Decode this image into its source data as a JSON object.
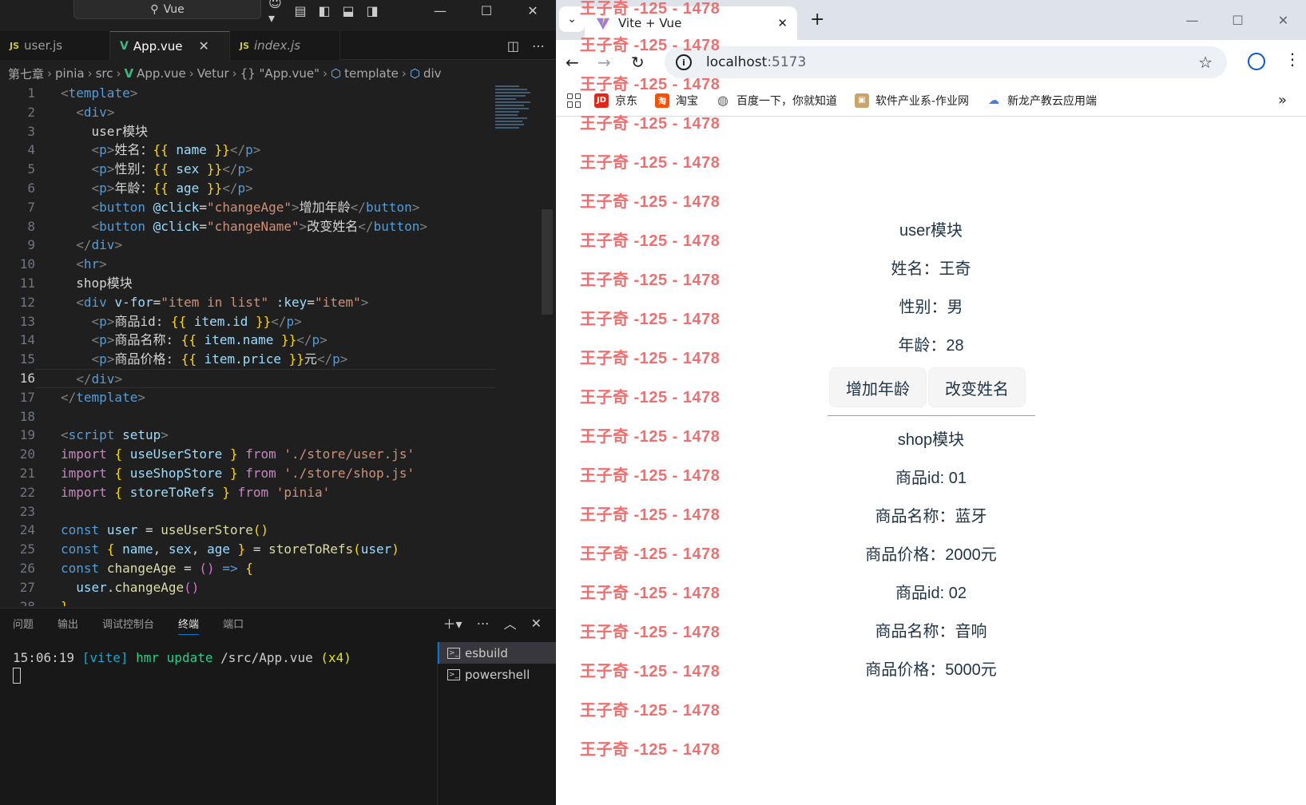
{
  "vscode": {
    "search_label": "Vue",
    "tabs": [
      {
        "icon": "JS",
        "label": "user.js"
      },
      {
        "icon": "V",
        "label": "App.vue"
      },
      {
        "icon": "JS",
        "label": "index.js"
      }
    ],
    "breadcrumb": [
      "第七章",
      "pinia",
      "src",
      "App.vue",
      "Vetur",
      "{} \"App.vue\"",
      "template",
      "div"
    ],
    "line_numbers": [
      "1",
      "2",
      "3",
      "4",
      "5",
      "6",
      "7",
      "8",
      "9",
      "10",
      "11",
      "12",
      "13",
      "14",
      "15",
      "16",
      "17",
      "18",
      "19",
      "20",
      "21",
      "22",
      "23",
      "24",
      "25",
      "26",
      "27",
      "28"
    ],
    "code": {
      "open_template": "template",
      "div": "div",
      "user_module": "user模块",
      "p": "p",
      "name_label": "姓名：",
      "sex_label": "性别：",
      "age_label": "年龄：",
      "var_name": "name",
      "var_sex": "sex",
      "var_age": "age",
      "button": "button",
      "click_attr": "@click",
      "change_age": "\"changeAge\"",
      "change_age_text": "增加年龄",
      "change_name": "\"changeName\"",
      "change_name_text": "改变姓名",
      "hr": "hr",
      "shop_module": "shop模块",
      "vfor_attr": "v-for",
      "vfor_val": "\"item in list\"",
      "key_attr": ":key",
      "key_val": "\"item\"",
      "item_id_label": "商品id: ",
      "item_name_label": "商品名称: ",
      "item_price_label": "商品价格: ",
      "item_id": "item.id",
      "item_name": "item.name",
      "item_price": "item.price",
      "yuan": "元",
      "script": "script",
      "setup": "setup",
      "import": "import",
      "from": "from",
      "useUserStore": "useUserStore",
      "useShopStore": "useShopStore",
      "storeToRefs": "storeToRefs",
      "path_user": "'./store/user.js'",
      "path_shop": "'./store/shop.js'",
      "path_pinia": "'pinia'",
      "const": "const",
      "user": "user",
      "changeAge": "changeAge",
      "call_change_age": "changeAge"
    },
    "panel_tabs": [
      "问题",
      "输出",
      "调试控制台",
      "终端",
      "端口"
    ],
    "terminal": {
      "time": "15:06:19",
      "tag": "[vite]",
      "hmr": "hmr update",
      "path": "/src/App.vue",
      "count": "(x4)"
    },
    "terminals": [
      "esbuild",
      "powershell"
    ]
  },
  "browser": {
    "tab_title": "Vite + Vue",
    "url_host": "localhost",
    "url_port": ":5173",
    "bookmarks": [
      {
        "label": "京东",
        "icon": "JD",
        "color": "#e1251b"
      },
      {
        "label": "淘宝",
        "icon": "淘",
        "color": "#ff5000"
      },
      {
        "label": "百度一下，你就知道",
        "icon": "globe",
        "color": "#5f6368"
      },
      {
        "label": "软件产业系-作业网",
        "icon": "img",
        "color": "#b08040"
      },
      {
        "label": "新龙产教云应用端",
        "icon": "cloud",
        "color": "#4a7fd8"
      }
    ],
    "page": {
      "user_title": "user模块",
      "name": "姓名：王奇",
      "sex": "性别：男",
      "age": "年龄：28",
      "btn_age": "增加年龄",
      "btn_name": "改变姓名",
      "shop_title": "shop模块",
      "items": [
        {
          "id": "商品id: 01",
          "name": "商品名称：蓝牙",
          "price": "商品价格：2000元"
        },
        {
          "id": "商品id: 02",
          "name": "商品名称：音响",
          "price": "商品价格：5000元"
        }
      ]
    },
    "watermark": "王子奇 -125 - 1478"
  }
}
